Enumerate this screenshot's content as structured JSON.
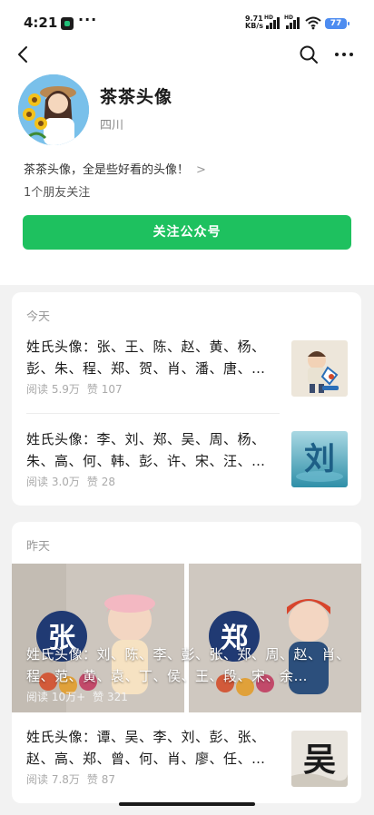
{
  "status_bar": {
    "time": "4:21",
    "dots": "···",
    "net_speed_value": "9.71",
    "net_speed_unit": "KB/s",
    "signal_label": "HD",
    "battery": "77"
  },
  "account": {
    "name": "茶茶头像",
    "region": "四川",
    "description": "茶茶头像，全是些好看的头像！",
    "friends_following": "1个朋友关注",
    "follow_button": "关注公众号"
  },
  "sections": [
    {
      "day": "今天",
      "articles": [
        {
          "title": "姓氏头像：张、王、陈、赵、黄、杨、彭、朱、程、郑、贺、肖、潘、唐、…",
          "reads": "阅读 5.9万",
          "likes": "赞 107"
        },
        {
          "title": "姓氏头像：李、刘、郑、吴、周、杨、朱、高、何、韩、彭、许、宋、汪、…",
          "reads": "阅读 3.0万",
          "likes": "赞 28",
          "thumb_char": "刘"
        }
      ]
    },
    {
      "day": "昨天",
      "featured": {
        "title": "姓氏头像：刘、陈、李、彭、张、郑、周、赵、肖、程、范、黄、袁、丁、侯、王、段、宋、余…",
        "reads": "阅读 10万+",
        "likes": "赞 321",
        "img_left_char": "张",
        "img_right_char": "郑"
      },
      "articles": [
        {
          "title": "姓氏头像：谭、吴、李、刘、彭、张、赵、高、郑、曾、何、肖、廖、任、…",
          "reads": "阅读 7.8万",
          "likes": "赞 87",
          "thumb_char": "吴"
        }
      ]
    }
  ],
  "colors": {
    "accent_green": "#1ec15f",
    "battery_blue": "#4d8cf0"
  },
  "icons": {
    "back": "back-arrow-icon",
    "search": "search-icon",
    "more": "more-icon"
  }
}
